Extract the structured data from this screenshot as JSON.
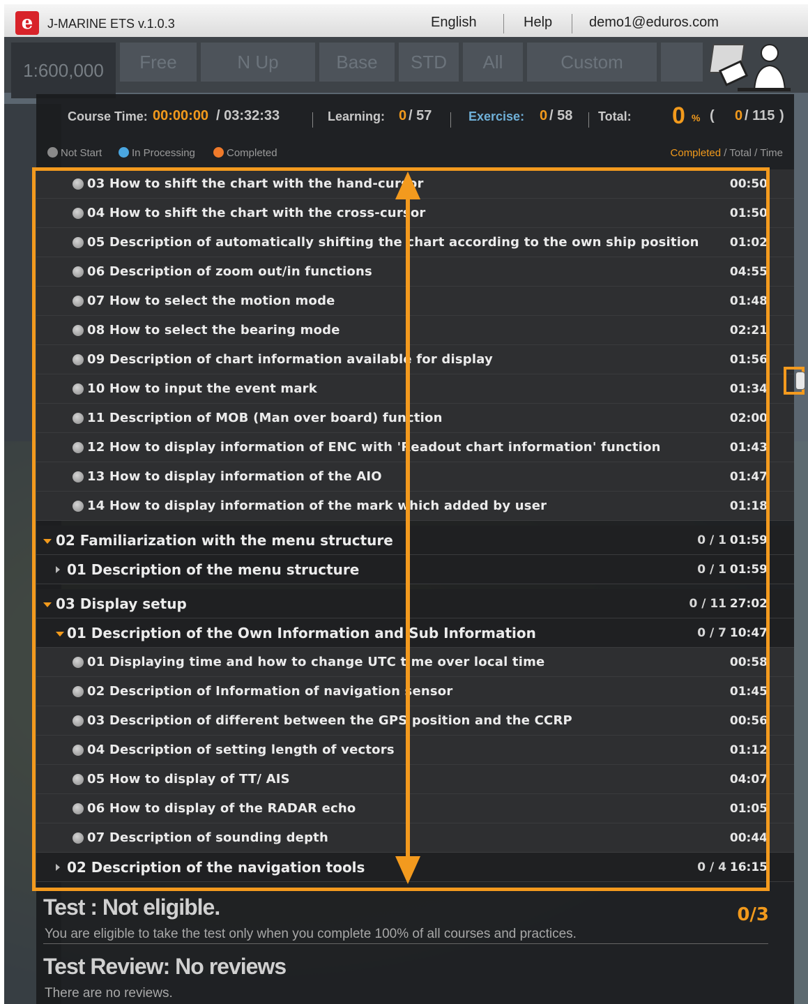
{
  "app": {
    "logo_letter": "e",
    "title": "J-MARINE ETS  v.1.0.3"
  },
  "top_nav": {
    "language": "English",
    "help": "Help",
    "user": "demo1@eduros.com"
  },
  "toolbar": {
    "scale": "1:600,000",
    "buttons": [
      "Free",
      "N Up",
      "Base",
      "STD",
      "All",
      "Custom"
    ]
  },
  "status": {
    "course_time_label": "Course Time:",
    "course_time_elapsed": "00:00:00",
    "course_time_total": "/ 03:32:33",
    "learning_label": "Learning:",
    "learning_done": "0",
    "learning_total": "/ 57",
    "exercise_label": "Exercise:",
    "exercise_done": "0",
    "exercise_total": "/ 58",
    "total_label": "Total:",
    "percent": "0",
    "percent_sign": "%",
    "open_paren": "(",
    "total_done": "0",
    "total_total": "/ 115",
    "close_paren": ")"
  },
  "legend": {
    "not_start": "Not Start",
    "in_processing": "In Processing",
    "completed": "Completed",
    "header_completed": "Completed",
    "header_rest": " / Total / Time",
    "colors": {
      "not_start": "#8a8a8a",
      "in_processing": "#4aa6e0",
      "completed": "#f07a2a"
    }
  },
  "rows": [
    {
      "type": "item",
      "label": "03 How to shift the chart with the hand-cursor",
      "dur": "00:50"
    },
    {
      "type": "item",
      "label": "04 How to shift the chart with the cross-cursor",
      "dur": "01:50"
    },
    {
      "type": "item",
      "label": "05 Description of automatically shifting the chart according to the own ship position",
      "dur": "01:02"
    },
    {
      "type": "item",
      "label": "06 Description of zoom out/in functions",
      "dur": "04:55"
    },
    {
      "type": "item",
      "label": "07 How to select the motion mode",
      "dur": "01:48"
    },
    {
      "type": "item",
      "label": "08 How to select the bearing mode",
      "dur": "02:21"
    },
    {
      "type": "item",
      "label": "09 Description of chart information available for display",
      "dur": "01:56"
    },
    {
      "type": "item",
      "label": "10 How to input the event mark",
      "dur": "01:34"
    },
    {
      "type": "item",
      "label": "11 Description of MOB (Man over board) function",
      "dur": "02:00"
    },
    {
      "type": "item",
      "label": "12 How to display information of ENC with 'Readout chart information' function",
      "dur": "01:43"
    },
    {
      "type": "item",
      "label": "13 How to display information of the AIO",
      "dur": "01:47"
    },
    {
      "type": "item",
      "label": "14 How to display information of the mark which added by user",
      "dur": "01:18"
    },
    {
      "type": "group",
      "level": 1,
      "expanded": true,
      "label": "02 Familiarization with the menu structure",
      "cnt": "0 / 1",
      "dur": "01:59"
    },
    {
      "type": "group",
      "level": 2,
      "expanded": false,
      "label": "01 Description of the menu structure",
      "cnt": "0 / 1",
      "dur": "01:59"
    },
    {
      "type": "group",
      "level": 1,
      "expanded": true,
      "label": "03 Display setup",
      "cnt": "0 / 11",
      "dur": "27:02"
    },
    {
      "type": "group",
      "level": 2,
      "expanded": true,
      "label": "01 Description of the Own Information and Sub Information",
      "cnt": "0 / 7",
      "dur": "10:47"
    },
    {
      "type": "item",
      "label": "01 Displaying time and how to change UTC time over local time",
      "dur": "00:58"
    },
    {
      "type": "item",
      "label": "02 Description of Information of navigation sensor",
      "dur": "01:45"
    },
    {
      "type": "item",
      "label": "03 Description of different between the GPS position and the CCRP",
      "dur": "00:56"
    },
    {
      "type": "item",
      "label": "04 Description of setting length of vectors",
      "dur": "01:12"
    },
    {
      "type": "item",
      "label": "05 How to display of TT/ AIS",
      "dur": "04:07"
    },
    {
      "type": "item",
      "label": "06 How to display of the RADAR echo",
      "dur": "01:05"
    },
    {
      "type": "item",
      "label": "07 Description of sounding depth",
      "dur": "00:44"
    },
    {
      "type": "group",
      "level": 2,
      "expanded": false,
      "label": "02 Description of the navigation tools",
      "cnt": "0 / 4",
      "dur": "16:15"
    }
  ],
  "test": {
    "title": "Test : Not eligible.",
    "desc": "You are eligible to take the test only when you complete 100% of all courses and practices.",
    "count": "0/3",
    "review_title": "Test Review: No reviews",
    "review_desc": "There are no reviews."
  },
  "accent_color": "#f29a1c"
}
